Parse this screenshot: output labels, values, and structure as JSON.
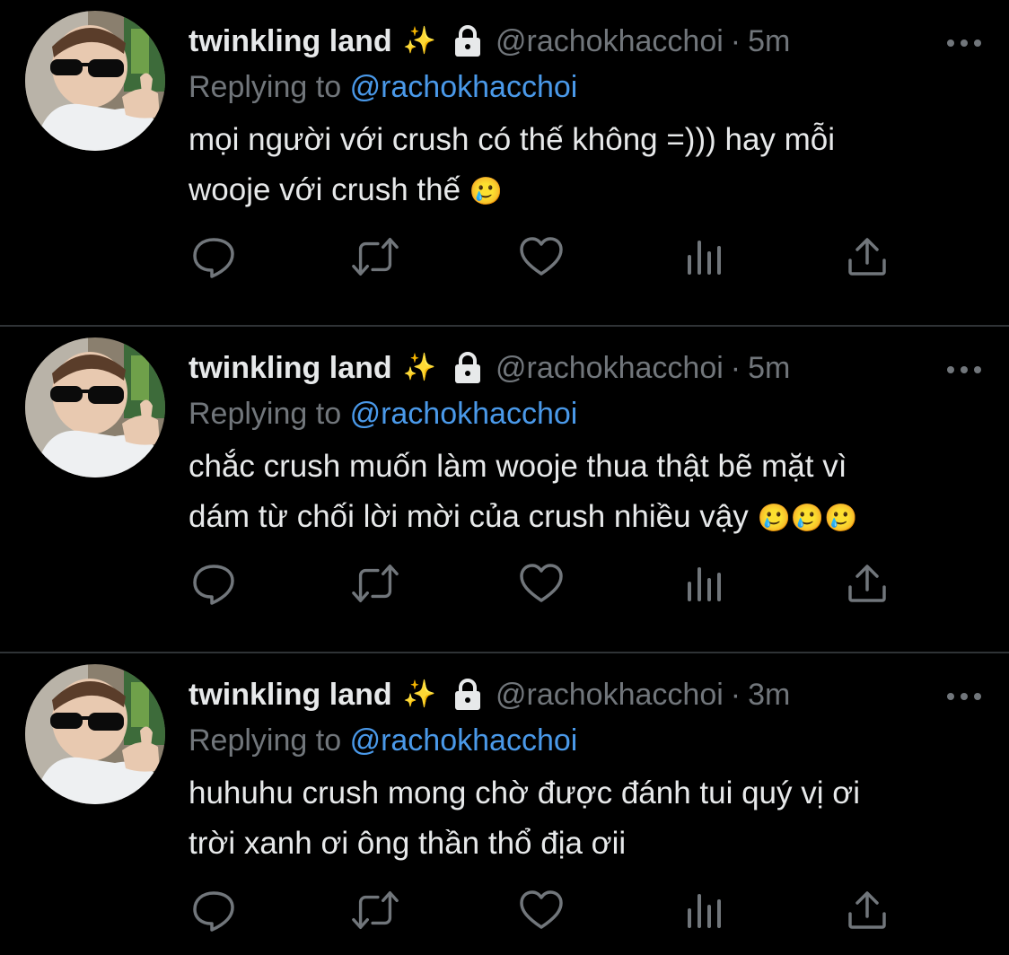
{
  "tweets": [
    {
      "name": "twinkling land",
      "sparkle": "✨",
      "handle": "@rachokhacchoi",
      "dot": "·",
      "time": "5m",
      "replying_prefix": "Replying to",
      "replying_handle": "@rachokhacchoi",
      "text_line1": "mọi người với crush có thế không =))) hay mỗi",
      "text_line2": "wooje với crush thế",
      "emoji": "🥲"
    },
    {
      "name": "twinkling land",
      "sparkle": "✨",
      "handle": "@rachokhacchoi",
      "dot": "·",
      "time": "5m",
      "replying_prefix": "Replying to",
      "replying_handle": "@rachokhacchoi",
      "text_line1": "chắc crush muốn làm wooje thua thật bẽ mặt vì",
      "text_line2": "dám từ chối lời mời của crush nhiều vậy",
      "emoji": "🥲🥲🥲"
    },
    {
      "name": "twinkling land",
      "sparkle": "✨",
      "handle": "@rachokhacchoi",
      "dot": "·",
      "time": "3m",
      "replying_prefix": "Replying to",
      "replying_handle": "@rachokhacchoi",
      "text_line1": "huhuhu crush mong chờ được đánh tui quý vị ơi",
      "text_line2": "trời xanh ơi ông thần thổ địa ơii",
      "emoji": ""
    }
  ],
  "icons": {
    "lock": "lock-icon",
    "more": "more-icon",
    "reply": "reply-icon",
    "retweet": "retweet-icon",
    "like": "heart-icon",
    "views": "views-icon",
    "share": "share-icon"
  },
  "colors": {
    "background": "#000000",
    "text": "#e7e9ea",
    "muted": "#71767b",
    "link": "#4a99e9",
    "divider": "#2f3336"
  }
}
